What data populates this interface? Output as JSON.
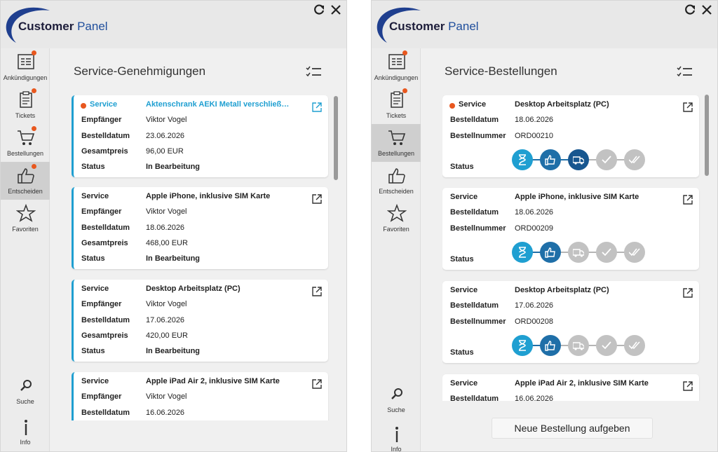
{
  "app": {
    "logo_text_main": "Customer",
    "logo_text_accent": "Panel",
    "colors": {
      "accent": "#1f9fd1",
      "brand": "#1f4e9c",
      "notification": "#e8571e"
    }
  },
  "nav": {
    "announcements": "Ankündigungen",
    "tickets": "Tickets",
    "orders": "Bestellungen",
    "decide": "Entscheiden",
    "favorites": "Favoriten",
    "search": "Suche",
    "info": "Info"
  },
  "left": {
    "title": "Service-Genehmigungen",
    "labels": {
      "service": "Service",
      "recipient": "Empfänger",
      "order_date": "Bestelldatum",
      "total": "Gesamtpreis",
      "status": "Status"
    },
    "cards": [
      {
        "service": "Aktenschrank AEKI Metall verschließ…",
        "recipient": "Viktor Vogel",
        "order_date": "23.06.2026",
        "total": "96,00 EUR",
        "status": "In Bearbeitung"
      },
      {
        "service": "Apple iPhone, inklusive SIM Karte",
        "recipient": "Viktor Vogel",
        "order_date": "18.06.2026",
        "total": "468,00 EUR",
        "status": "In Bearbeitung"
      },
      {
        "service": "Desktop Arbeitsplatz (PC)",
        "recipient": "Viktor Vogel",
        "order_date": "17.06.2026",
        "total": "420,00 EUR",
        "status": "In Bearbeitung"
      },
      {
        "service": "Apple iPad Air 2, inklusive SIM Karte",
        "recipient": "Viktor Vogel",
        "order_date": "16.06.2026"
      }
    ]
  },
  "right": {
    "title": "Service-Bestellungen",
    "labels": {
      "service": "Service",
      "order_date": "Bestelldatum",
      "order_number": "Bestellnummer",
      "status": "Status"
    },
    "cards": [
      {
        "service": "Desktop Arbeitsplatz (PC)",
        "order_date": "18.06.2026",
        "order_number": "ORD00210",
        "status_steps_done": 3
      },
      {
        "service": "Apple iPhone, inklusive SIM Karte",
        "order_date": "18.06.2026",
        "order_number": "ORD00209",
        "status_steps_done": 2
      },
      {
        "service": "Desktop Arbeitsplatz (PC)",
        "order_date": "17.06.2026",
        "order_number": "ORD00208",
        "status_steps_done": 2
      },
      {
        "service": "Apple iPad Air 2, inklusive SIM Karte",
        "order_date": "16.06.2026"
      }
    ],
    "new_order_button": "Neue Bestellung aufgeben"
  }
}
